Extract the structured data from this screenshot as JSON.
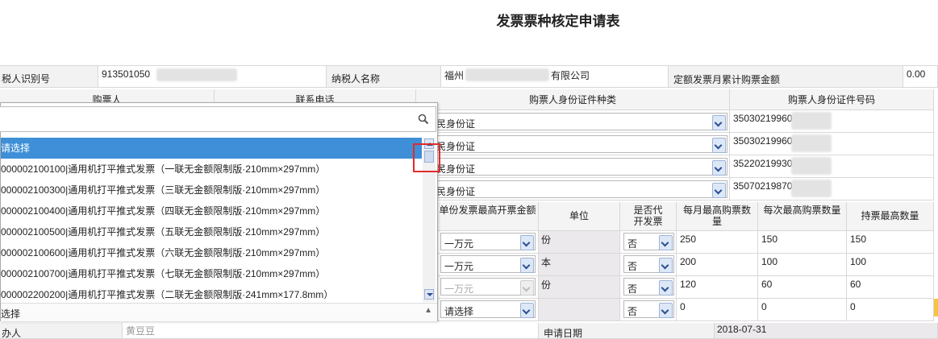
{
  "title": "发票票种核定申请表",
  "info": {
    "taxpayer_id_label": "税人识别号",
    "taxpayer_id_value": "913501050",
    "taxpayer_name_label": "纳税人名称",
    "taxpayer_name_prefix": "福州",
    "taxpayer_name_suffix": "有限公司",
    "monthly_amount_label": "定额发票月累计购票金额",
    "monthly_amount_value": "0.00"
  },
  "buyers": {
    "headers": [
      "购票人",
      "联系电话",
      "购票人身份证件种类",
      "购票人身份证件号码"
    ],
    "rows": [
      {
        "id_type": "民身份证",
        "id_number": "35030219960"
      },
      {
        "id_type": "民身份证",
        "id_number": "35030219960"
      },
      {
        "id_type": "民身份证",
        "id_number": "35220219930"
      },
      {
        "id_type": "民身份证",
        "id_number": "35070219870"
      }
    ]
  },
  "invoices": {
    "headers": {
      "max_amount": "单份发票最高开票金额",
      "unit": "单位",
      "proxy": "是否代开发票",
      "monthly_max": "每月最高购票数量",
      "per_max": "每次最高购票数量",
      "hold_max": "持票最高数量"
    },
    "rows": [
      {
        "max_amount": "一万元",
        "unit": "份",
        "proxy": "否",
        "monthly": "250",
        "per": "150",
        "hold": "150"
      },
      {
        "max_amount": "一万元",
        "unit": "本",
        "proxy": "否",
        "monthly": "200",
        "per": "100",
        "hold": "100"
      },
      {
        "max_amount": "一万元",
        "unit": "份",
        "proxy": "否",
        "monthly": "120",
        "per": "60",
        "hold": "60"
      },
      {
        "max_amount": "请选择",
        "unit": "",
        "proxy": "否",
        "monthly": "0",
        "per": "0",
        "hold": "0"
      }
    ]
  },
  "footer": {
    "handler_label": "办人",
    "handler_value": "黄豆豆",
    "date_label": "申请日期",
    "date_value": "2018-07-31"
  },
  "dropdown": {
    "search_icon": "search-icon",
    "options": [
      "请选择",
      "000002100100|通用机打平推式发票（一联无金额限制版·210mm×297mm）",
      "000002100300|通用机打平推式发票（三联无金额限制版·210mm×297mm）",
      "000002100400|通用机打平推式发票（四联无金额限制版·210mm×297mm）",
      "000002100500|通用机打平推式发票（五联无金额限制版·210mm×297mm）",
      "000002100600|通用机打平推式发票（六联无金额限制版·210mm×297mm）",
      "000002100700|通用机打平推式发票（七联无金额限制版·210mm×297mm）",
      "000002200200|通用机打平推式发票（二联无金额限制版·241mm×177.8mm）"
    ],
    "selected_text": "选择"
  },
  "colors": {
    "highlight": "#3e8fd7",
    "annotation": "#e12b2b"
  }
}
